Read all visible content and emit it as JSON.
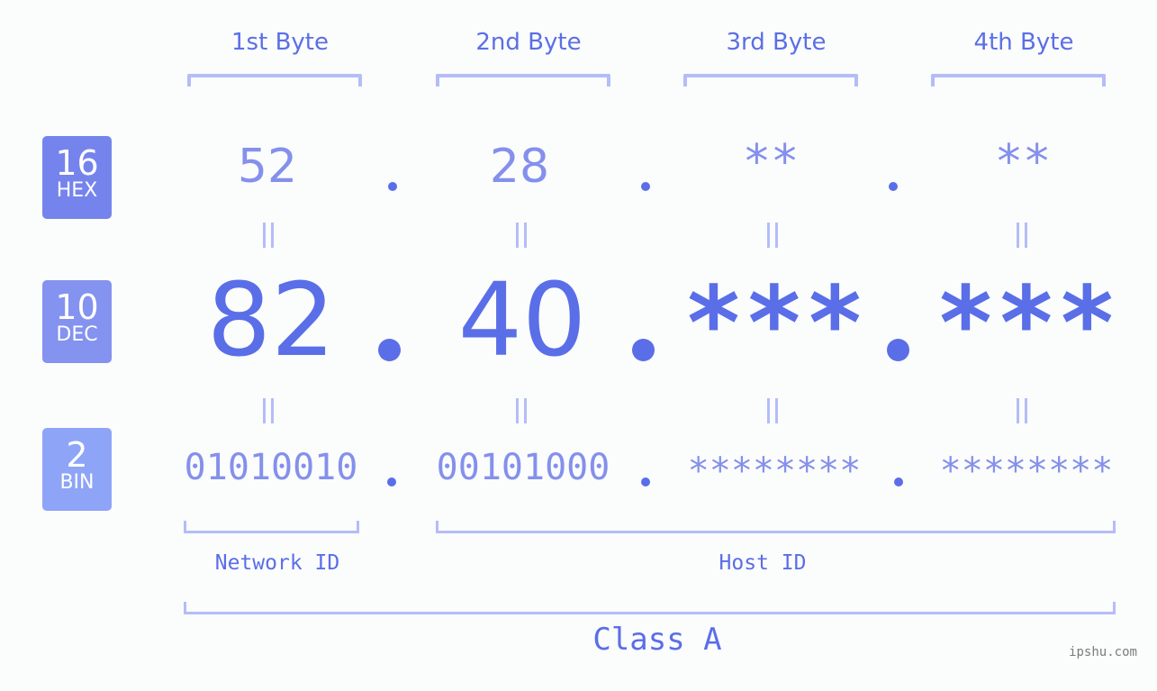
{
  "bytes": [
    {
      "title": "1st Byte",
      "hex": "52",
      "dec": "82",
      "bin": "01010010"
    },
    {
      "title": "2nd Byte",
      "hex": "28",
      "dec": "40",
      "bin": "00101000"
    },
    {
      "title": "3rd Byte",
      "hex": "**",
      "dec": "***",
      "bin": "********"
    },
    {
      "title": "4th Byte",
      "hex": "**",
      "dec": "***",
      "bin": "********"
    }
  ],
  "badges": {
    "hex": {
      "num": "16",
      "label": "HEX",
      "color": "#7584ec"
    },
    "dec": {
      "num": "10",
      "label": "DEC",
      "color": "#8492f0"
    },
    "bin": {
      "num": "2",
      "label": "BIN",
      "color": "#8ea4f7"
    }
  },
  "labels": {
    "network_id": "Network ID",
    "host_id": "Host ID",
    "class": "Class A"
  },
  "watermark": "ipshu.com",
  "colors": {
    "accent": "#5a6ee8",
    "light_accent": "#8490ec",
    "bracket": "#b4bdf7",
    "background": "#fbfcfc"
  }
}
